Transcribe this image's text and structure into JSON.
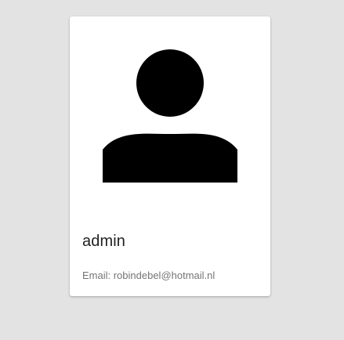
{
  "profile": {
    "avatar_icon": "person-icon",
    "username": "admin",
    "email_text": "Email: robindebel@hotmail.nl"
  },
  "colors": {
    "page_background": "#e3e3e3",
    "card_background": "#ffffff",
    "icon_color": "#000000",
    "title_color": "#212121",
    "secondary_text_color": "#757575"
  }
}
